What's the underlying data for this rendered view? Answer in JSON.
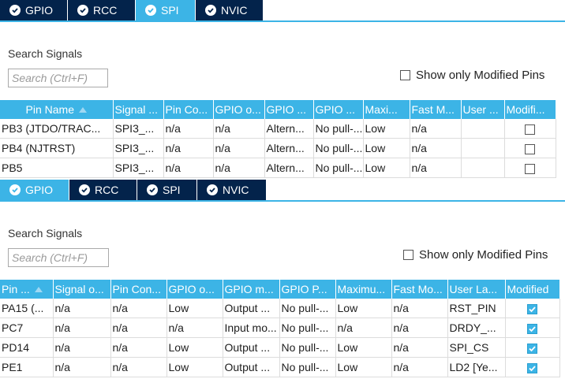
{
  "panel1": {
    "tabs": [
      {
        "label": "GPIO",
        "active": false
      },
      {
        "label": "RCC",
        "active": false
      },
      {
        "label": "SPI",
        "active": true
      },
      {
        "label": "NVIC",
        "active": false
      }
    ],
    "search_label": "Search Signals",
    "search_placeholder": "Search (Ctrl+F)",
    "modified_only_label": "Show only Modified Pins",
    "columns": [
      "Pin Name",
      "Signal ...",
      "Pin Co...",
      "GPIO o...",
      "GPIO ...",
      "GPIO ...",
      "Maxi...",
      "Fast M...",
      "User ...",
      "Modifi..."
    ],
    "rows": [
      {
        "cells": [
          "PB3 (JTDO/TRAC...",
          "SPI3_...",
          "n/a",
          "n/a",
          "Altern...",
          "No pull-...",
          "Low",
          "n/a",
          ""
        ],
        "modified": false
      },
      {
        "cells": [
          "PB4 (NJTRST)",
          "SPI3_...",
          "n/a",
          "n/a",
          "Altern...",
          "No pull-...",
          "Low",
          "n/a",
          ""
        ],
        "modified": false
      },
      {
        "cells": [
          "PB5",
          "SPI3_...",
          "n/a",
          "n/a",
          "Altern...",
          "No pull-...",
          "Low",
          "n/a",
          ""
        ],
        "modified": false
      }
    ]
  },
  "panel2": {
    "tabs": [
      {
        "label": "GPIO",
        "active": true
      },
      {
        "label": "RCC",
        "active": false
      },
      {
        "label": "SPI",
        "active": false
      },
      {
        "label": "NVIC",
        "active": false
      }
    ],
    "search_label": "Search Signals",
    "search_placeholder": "Search (Ctrl+F)",
    "modified_only_label": "Show only Modified Pins",
    "columns": [
      "Pin ...",
      "Signal o...",
      "Pin Con...",
      "GPIO o...",
      "GPIO m...",
      "GPIO P...",
      "Maximu...",
      "Fast Mo...",
      "User La...",
      "Modified"
    ],
    "rows": [
      {
        "cells": [
          "PA15 (...",
          "n/a",
          "n/a",
          "Low",
          "Output ...",
          "No pull-...",
          "Low",
          "n/a",
          "RST_PIN"
        ],
        "modified": true
      },
      {
        "cells": [
          "PC7",
          "n/a",
          "n/a",
          "n/a",
          "Input mo...",
          "No pull-...",
          "n/a",
          "n/a",
          "DRDY_..."
        ],
        "modified": true
      },
      {
        "cells": [
          "PD14",
          "n/a",
          "n/a",
          "Low",
          "Output ...",
          "No pull-...",
          "Low",
          "n/a",
          "SPI_CS"
        ],
        "modified": true
      },
      {
        "cells": [
          "PE1",
          "n/a",
          "n/a",
          "Low",
          "Output ...",
          "No pull-...",
          "Low",
          "n/a",
          "LD2 [Ye..."
        ],
        "modified": true
      }
    ]
  },
  "colors": {
    "accent": "#3cb4e6",
    "tab_dark": "#03234b"
  }
}
